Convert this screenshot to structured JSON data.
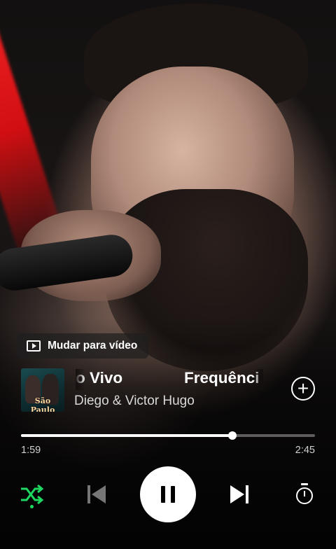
{
  "switch_to_video": {
    "label": "Mudar para vídeo",
    "icon": "video-play-icon"
  },
  "now_playing": {
    "title_part_1": "o Vivo",
    "title_part_2": "Frequênci",
    "artist": "Diego & Victor Hugo",
    "cover_text": "São Paulo",
    "add_icon": "plus-circle-icon"
  },
  "playback": {
    "current_time": "1:59",
    "total_time": "2:45",
    "progress": 0.72
  },
  "controls": {
    "shuffle_icon": "shuffle-icon",
    "prev_icon": "skip-previous-icon",
    "pause_icon": "pause-icon",
    "next_icon": "skip-next-icon",
    "timer_icon": "sleep-timer-icon",
    "accent": "#1ed760"
  }
}
